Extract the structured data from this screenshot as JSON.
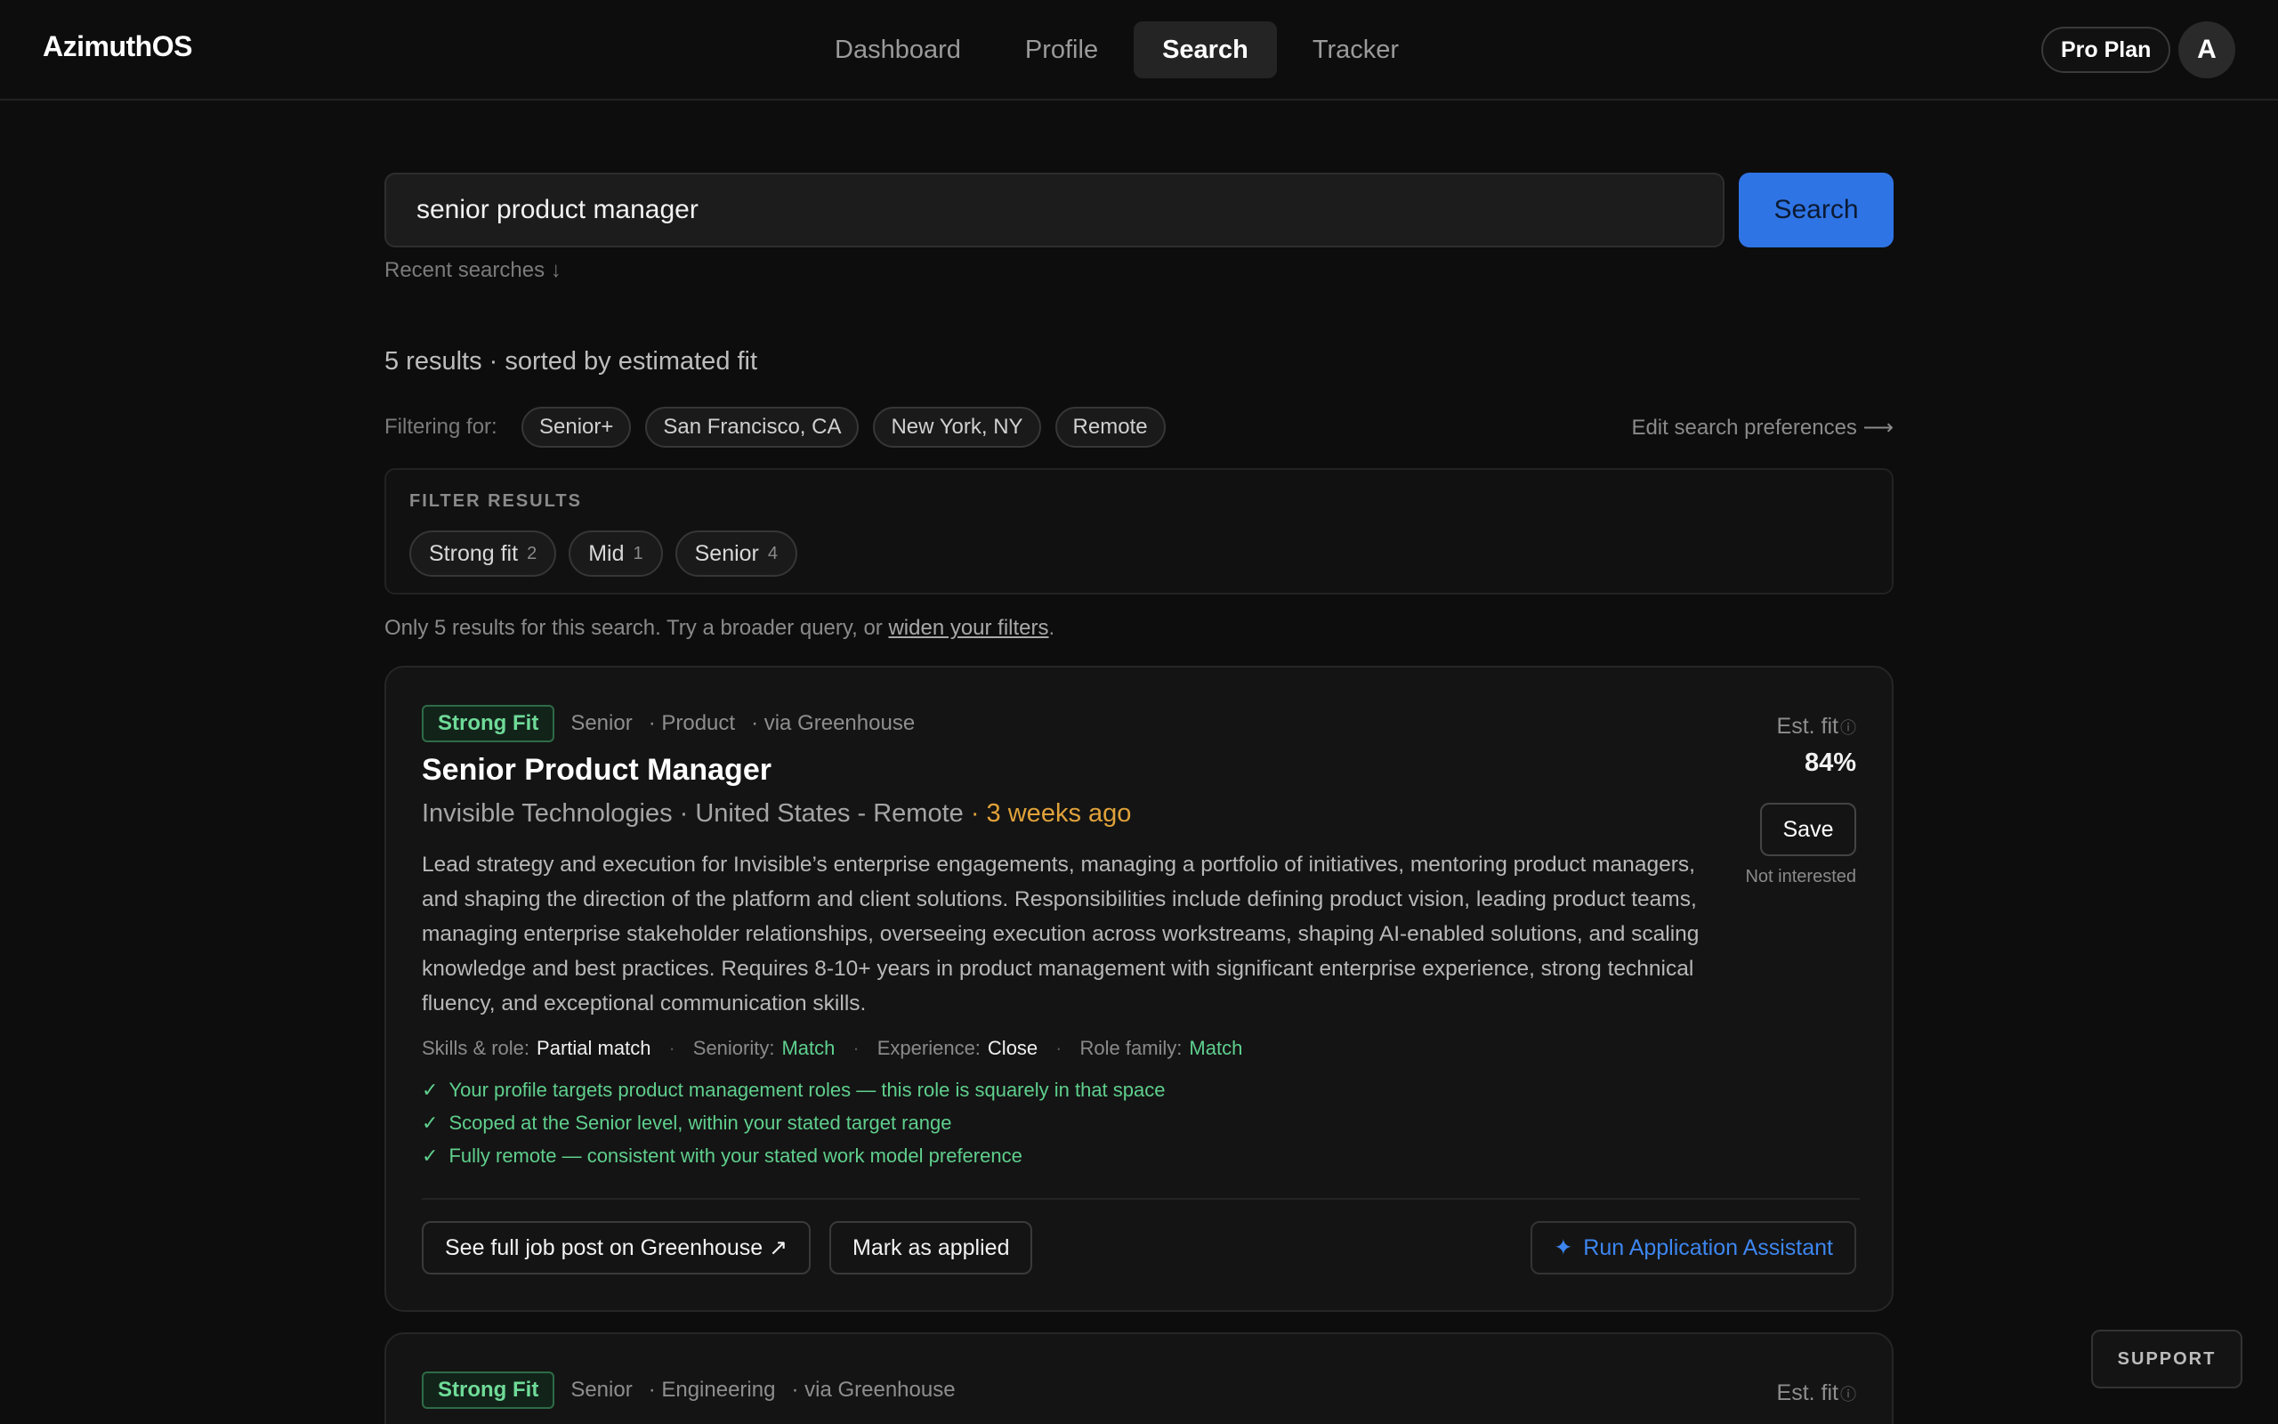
{
  "app": {
    "title": "AzimuthOS"
  },
  "nav": {
    "items": [
      {
        "label": "Dashboard",
        "active": false
      },
      {
        "label": "Profile",
        "active": false
      },
      {
        "label": "Search",
        "active": true
      },
      {
        "label": "Tracker",
        "active": false
      }
    ],
    "plan_badge": "Pro Plan",
    "avatar_initial": "A"
  },
  "search": {
    "query": "senior product manager",
    "button_label": "Search",
    "recent_label": "Recent searches ↓"
  },
  "results": {
    "summary": "5 results · sorted by estimated fit",
    "filtering_label": "Filtering for:",
    "active_filters": [
      "Senior+",
      "San Francisco, CA",
      "New York, NY",
      "Remote"
    ],
    "edit_prefs_label": "Edit search preferences ⟶",
    "filter_box": {
      "title": "FILTER RESULTS",
      "facets": [
        {
          "label": "Strong fit",
          "count": "2"
        },
        {
          "label": "Mid",
          "count": "1"
        },
        {
          "label": "Senior",
          "count": "4"
        }
      ]
    },
    "hint_prefix": "Only 5 results for this search. Try a broader query, or ",
    "hint_link": "widen your filters",
    "hint_suffix": "."
  },
  "jobs": [
    {
      "fit_badge": "Strong Fit",
      "seniority": "Senior",
      "department": "· Product",
      "source": "· via Greenhouse",
      "title": "Senior Product Manager",
      "company_location": "Invisible Technologies · United States - Remote",
      "posted": "· 3 weeks ago",
      "description": "Lead strategy and execution for Invisible’s enterprise engagements, managing a portfolio of initiatives, mentoring product managers, and shaping the direction of the platform and client solutions. Responsibilities include defining product vision, leading product teams, managing enterprise stakeholder relationships, overseeing execution across workstreams, shaping AI-enabled solutions, and scaling knowledge and best practices. Requires 8-10+ years in product management with significant enterprise experience, strong technical fluency, and exceptional communication skills.",
      "signals": [
        {
          "label": "Skills & role:",
          "value": "Partial match",
          "status": "neutral"
        },
        {
          "label": "Seniority:",
          "value": "Match",
          "status": "match"
        },
        {
          "label": "Experience:",
          "value": "Close",
          "status": "neutral"
        },
        {
          "label": "Role family:",
          "value": "Match",
          "status": "match"
        }
      ],
      "reasons": [
        "Your profile targets product management roles — this role is squarely in that space",
        "Scoped at the Senior level, within your stated target range",
        "Fully remote — consistent with your stated work model preference"
      ],
      "fit_label": "Est. fit",
      "fit_value": "84%",
      "save_label": "Save",
      "not_interested_label": "Not interested",
      "see_post_label": "See full job post on Greenhouse ↗",
      "mark_applied_label": "Mark as applied",
      "assistant_label": "Run Application Assistant"
    },
    {
      "fit_badge": "Strong Fit",
      "seniority": "Senior",
      "department": "· Engineering",
      "source": "· via Greenhouse",
      "fit_label": "Est. fit"
    }
  ],
  "support_label": "SUPPORT",
  "colors": {
    "background": "#0d0d0d",
    "accent_blue": "#2f74e4",
    "fit_green": "#6fdb98",
    "age_orange": "#e0a23a"
  }
}
